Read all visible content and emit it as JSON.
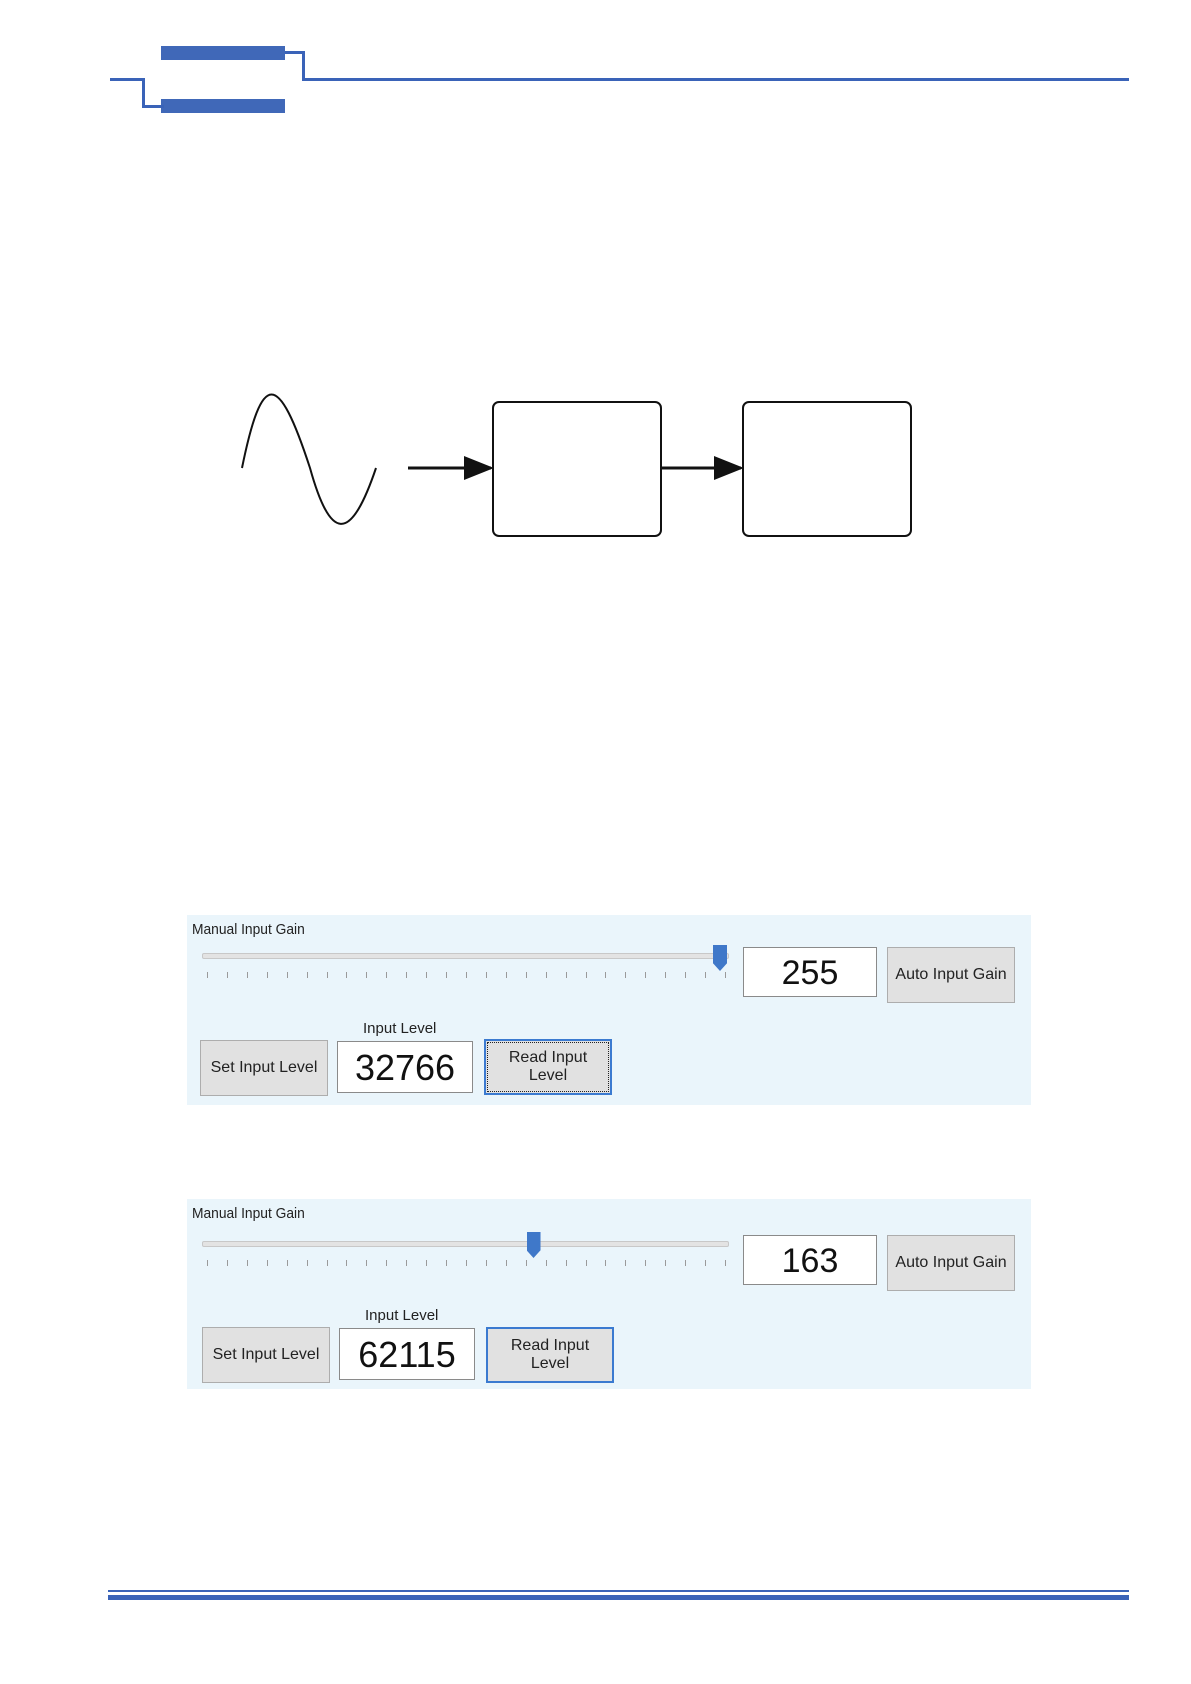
{
  "colors": {
    "accent": "#3a63b8",
    "panel_bg": "#eaf5fb",
    "slider_thumb": "#3f78c9"
  },
  "panels": [
    {
      "title": "Manual Input Gain",
      "gain_fraction": 1.0,
      "gain_value": "255",
      "auto_button": "Auto Input Gain",
      "set_button": "Set Input Level",
      "level_label": "Input Level",
      "level_value": "32766",
      "read_button_line1": "Read Input",
      "read_button_line2": "Level"
    },
    {
      "title": "Manual Input Gain",
      "gain_fraction": 0.64,
      "gain_value": "163",
      "auto_button": "Auto Input Gain",
      "set_button": "Set Input Level",
      "level_label": "Input Level",
      "level_value": "62115",
      "read_button_line1": "Read Input",
      "read_button_line2": "Level"
    }
  ]
}
